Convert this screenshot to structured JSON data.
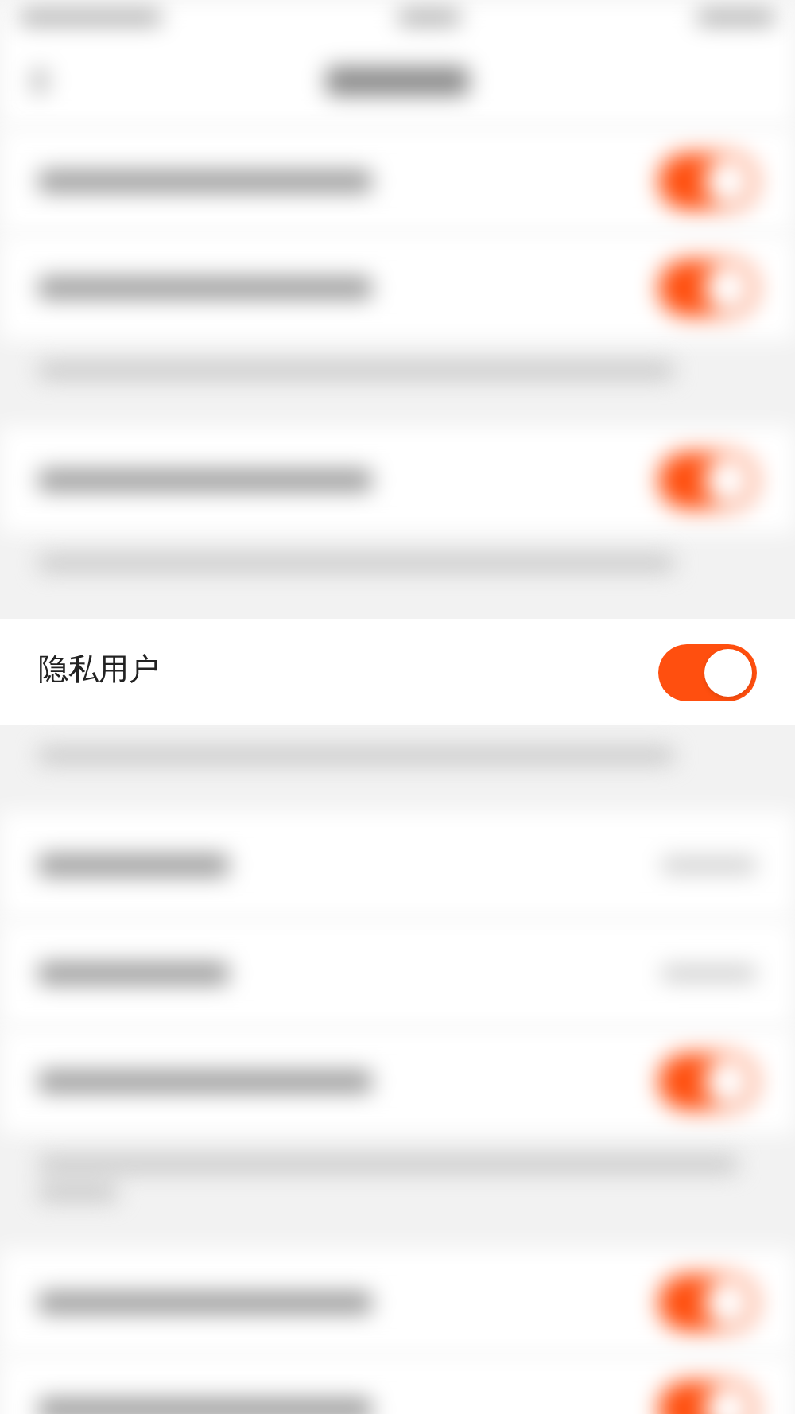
{
  "settings": [
    {
      "kind": "toggle",
      "blurred": true,
      "on": true
    },
    {
      "kind": "toggle",
      "blurred": true,
      "on": true
    },
    {
      "kind": "note",
      "blurred": true
    },
    {
      "kind": "gap"
    },
    {
      "kind": "toggle",
      "blurred": true,
      "on": true
    },
    {
      "kind": "note",
      "blurred": true
    },
    {
      "kind": "gap"
    },
    {
      "kind": "toggle",
      "blurred": false,
      "label": "隐私用户",
      "on": true
    },
    {
      "kind": "note",
      "blurred": true
    },
    {
      "kind": "gap"
    },
    {
      "kind": "link",
      "blurred": true
    },
    {
      "kind": "link",
      "blurred": true
    },
    {
      "kind": "toggle",
      "blurred": true,
      "on": true
    },
    {
      "kind": "note2",
      "blurred": true
    },
    {
      "kind": "gap"
    },
    {
      "kind": "toggle",
      "blurred": true,
      "on": true
    },
    {
      "kind": "toggle",
      "blurred": true,
      "on": true
    }
  ]
}
